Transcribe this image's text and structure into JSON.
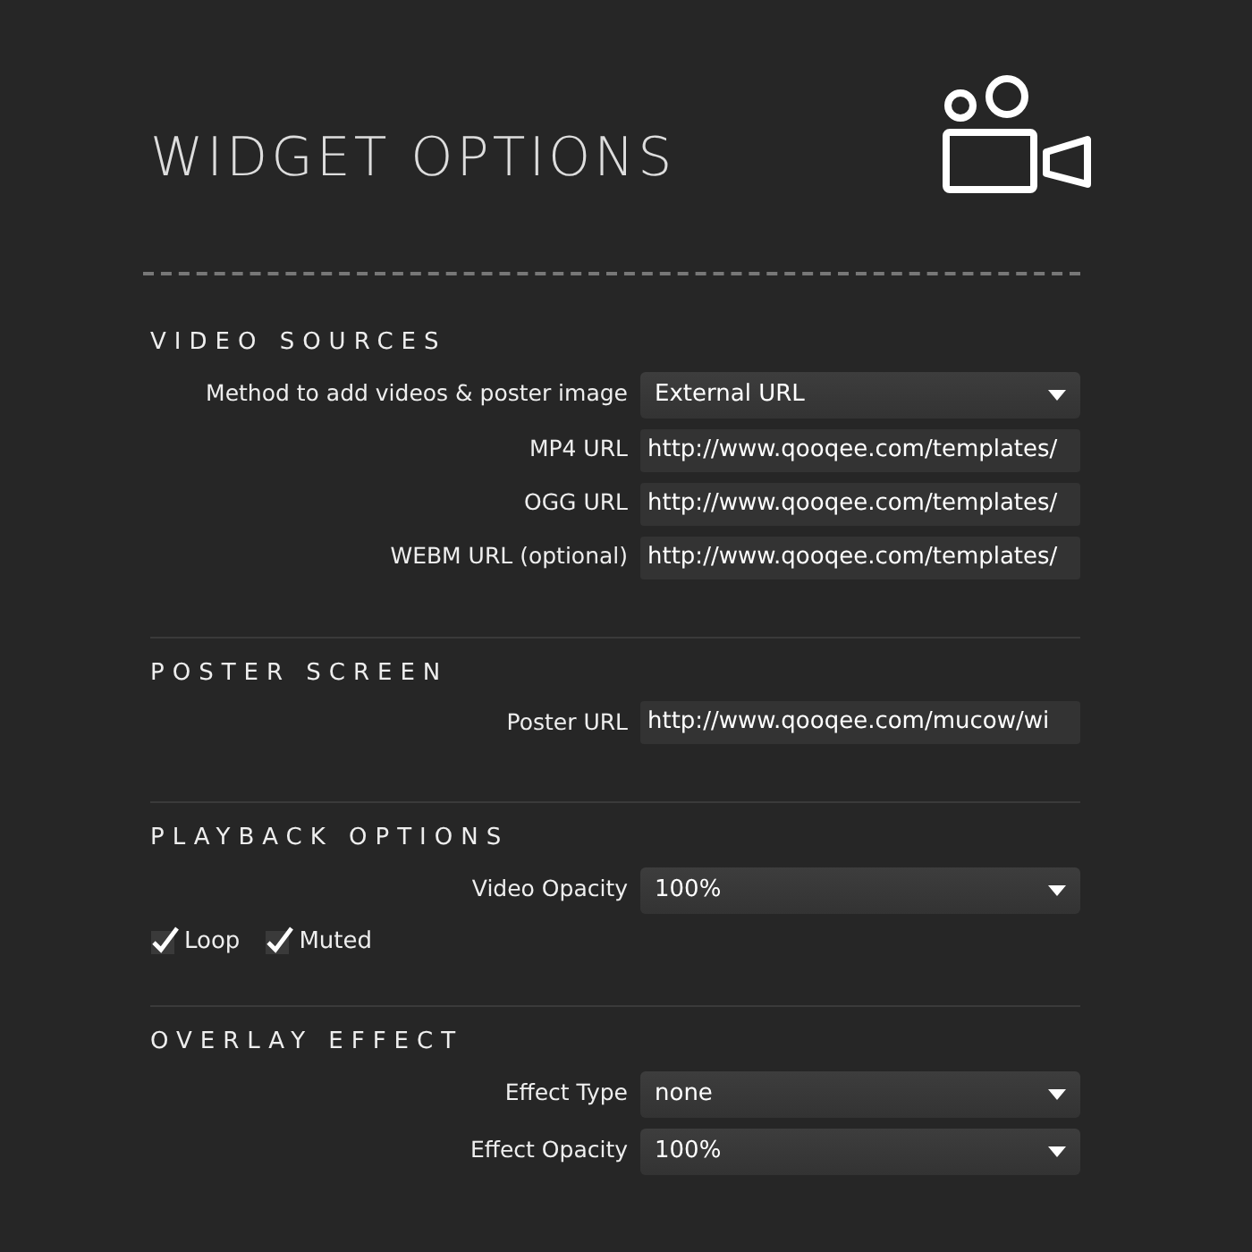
{
  "title": "WIDGET OPTIONS",
  "sections": [
    {
      "heading": "VIDEO SOURCES",
      "rows": [
        {
          "kind": "select",
          "label": "Method to add videos & poster image",
          "value": "External URL"
        },
        {
          "kind": "text",
          "label": "MP4 URL",
          "value": "http://www.qooqee.com/templates/"
        },
        {
          "kind": "text",
          "label": "OGG URL",
          "value": "http://www.qooqee.com/templates/"
        },
        {
          "kind": "text",
          "label": "WEBM URL (optional)",
          "value": "http://www.qooqee.com/templates/"
        }
      ]
    },
    {
      "heading": "POSTER SCREEN",
      "rows": [
        {
          "kind": "text",
          "label": "Poster URL",
          "value": "http://www.qooqee.com/mucow/wi"
        }
      ]
    },
    {
      "heading": "PLAYBACK OPTIONS",
      "rows": [
        {
          "kind": "select",
          "label": "Video Opacity",
          "value": "100%"
        },
        {
          "kind": "checks",
          "items": [
            {
              "label": "Loop",
              "checked": true
            },
            {
              "label": "Muted",
              "checked": true
            }
          ]
        }
      ]
    },
    {
      "heading": "OVERLAY EFFECT",
      "rows": [
        {
          "kind": "select",
          "label": "Effect Type",
          "value": "none"
        },
        {
          "kind": "select",
          "label": "Effect Opacity",
          "value": "100%"
        }
      ]
    }
  ]
}
